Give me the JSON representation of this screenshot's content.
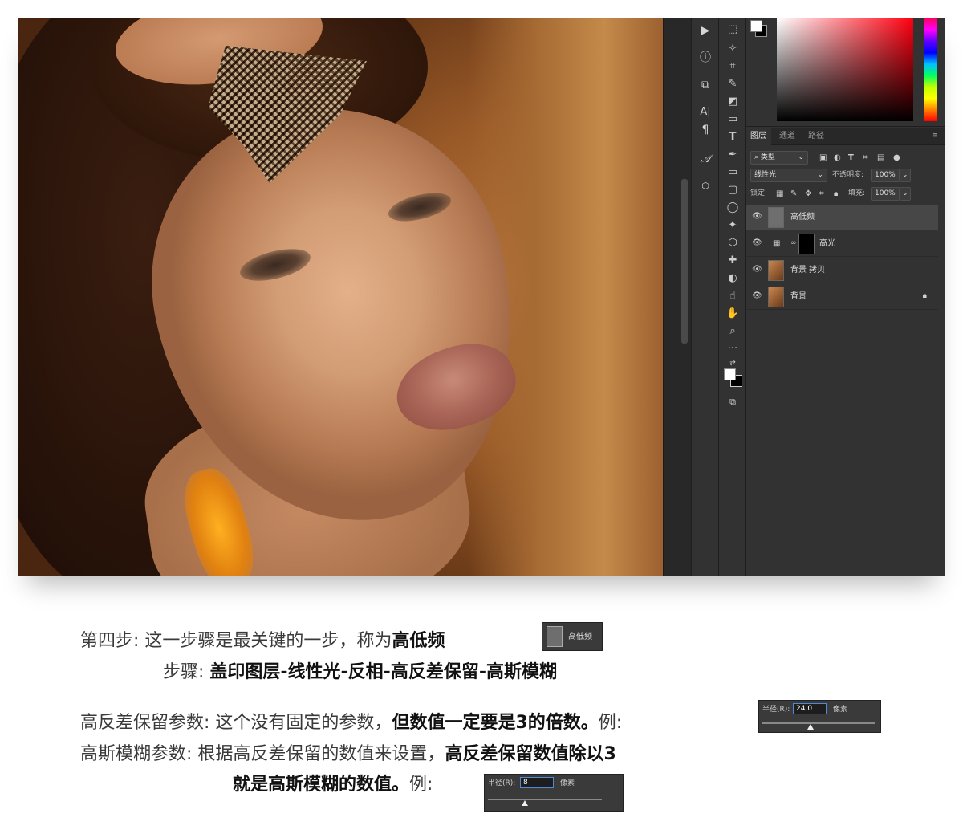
{
  "photoshop": {
    "layers_panel": {
      "tabs": [
        "图层",
        "通道",
        "路径"
      ],
      "filter_kind": "类型",
      "blend_mode": "线性光",
      "opacity_label": "不透明度:",
      "opacity_value": "100%",
      "lock_label": "锁定:",
      "fill_label": "填充:",
      "fill_value": "100%",
      "layers": [
        {
          "name": "高低频",
          "selected": true,
          "visible": true
        },
        {
          "name": "高光",
          "selected": false,
          "visible": true
        },
        {
          "name": "背景 拷贝",
          "selected": false,
          "visible": true
        },
        {
          "name": "背景",
          "selected": false,
          "visible": true,
          "locked": true
        }
      ]
    },
    "side_icons": [
      "play-icon",
      "info-icon",
      "adjust-icon",
      "character-icon",
      "paragraph-icon",
      "glyphs-icon",
      "3d-icon"
    ],
    "tools": [
      "move-tool",
      "marquee-tool",
      "magic-wand-tool",
      "crop-tool",
      "brush-tool",
      "eraser-tool",
      "gradient-tool",
      "type-tool",
      "pen-tool",
      "rectangle-tool",
      "rounded-rect-tool",
      "ellipse-tool",
      "custom-shape-tool",
      "polygon-tool",
      "healing-tool",
      "dodge-tool",
      "smudge-tool",
      "hand-tool",
      "zoom-tool",
      "more-tools"
    ]
  },
  "tutorial": {
    "step_label": "第四步:",
    "step_text": "这一步骤是最关键的一步，称为",
    "step_name": "高低频",
    "badge_layer_name": "高低频",
    "steps_label": "步骤:",
    "steps_text": "盖印图层-线性光-反相-高反差保留-高斯模糊",
    "hp_label": "高反差保留参数:",
    "hp_text": "这个没有固定的参数，",
    "hp_bold": "但数值一定要是3的倍数。",
    "hp_example": "例:",
    "hp_dialog": {
      "label": "半径(R):",
      "value": "24.0",
      "unit": "像素"
    },
    "gb_label": "高斯模糊参数:",
    "gb_text": "根据高反差保留的数值来设置，",
    "gb_bold1": "高反差保留数值除以3",
    "gb_bold2": "就是高斯模糊的数值。",
    "gb_example": "例:",
    "gb_dialog": {
      "label": "半径(R):",
      "value": "8",
      "unit": "像素"
    }
  }
}
